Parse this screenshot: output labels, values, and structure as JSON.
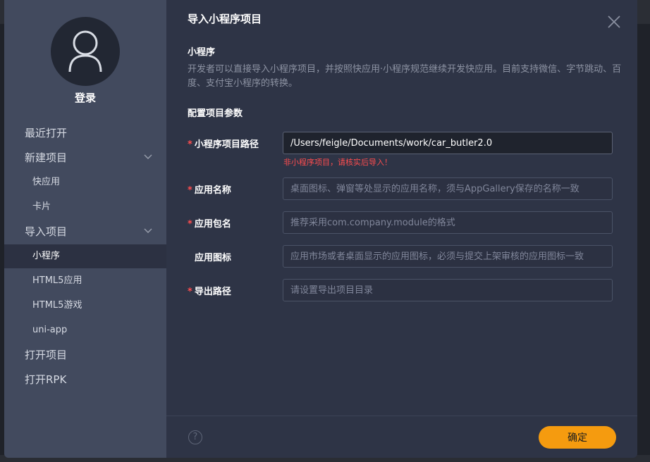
{
  "sidebar": {
    "login_label": "登录",
    "items": [
      {
        "label": "最近打开"
      },
      {
        "label": "新建项目"
      },
      {
        "label": "快应用"
      },
      {
        "label": "卡片"
      },
      {
        "label": "导入项目"
      },
      {
        "label": "小程序"
      },
      {
        "label": "HTML5应用"
      },
      {
        "label": "HTML5游戏"
      },
      {
        "label": "uni-app"
      },
      {
        "label": "打开项目"
      },
      {
        "label": "打开RPK"
      }
    ]
  },
  "dialog": {
    "title": "导入小程序项目",
    "section_title": "小程序",
    "description": "开发者可以直接导入小程序项目，并按照快应用·小程序规范继续开发快应用。目前支持微信、字节跳动、百度、支付宝小程序的转换。",
    "config_title": "配置项目参数",
    "fields": {
      "path": {
        "label": "小程序项目路径",
        "value": "/Users/feigle/Documents/work/car_butler2.0",
        "error": "非小程序项目，请核实后导入！"
      },
      "app_name": {
        "label": "应用名称",
        "placeholder": "桌面图标、弹窗等处显示的应用名称，须与AppGallery保存的名称一致"
      },
      "package_name": {
        "label": "应用包名",
        "placeholder": "推荐采用com.company.module的格式"
      },
      "app_icon": {
        "label": "应用图标",
        "placeholder": "应用市场或者桌面显示的应用图标，必须与提交上架审核的应用图标一致"
      },
      "export_path": {
        "label": "导出路径",
        "placeholder": "请设置导出项目目录"
      }
    },
    "required_mark": "*",
    "help_label": "?",
    "confirm_label": "确定"
  },
  "colors": {
    "accent": "#f59b0f",
    "error": "#ff4d4f",
    "sidebar_bg": "#424a5e",
    "main_bg": "#2e3446"
  }
}
